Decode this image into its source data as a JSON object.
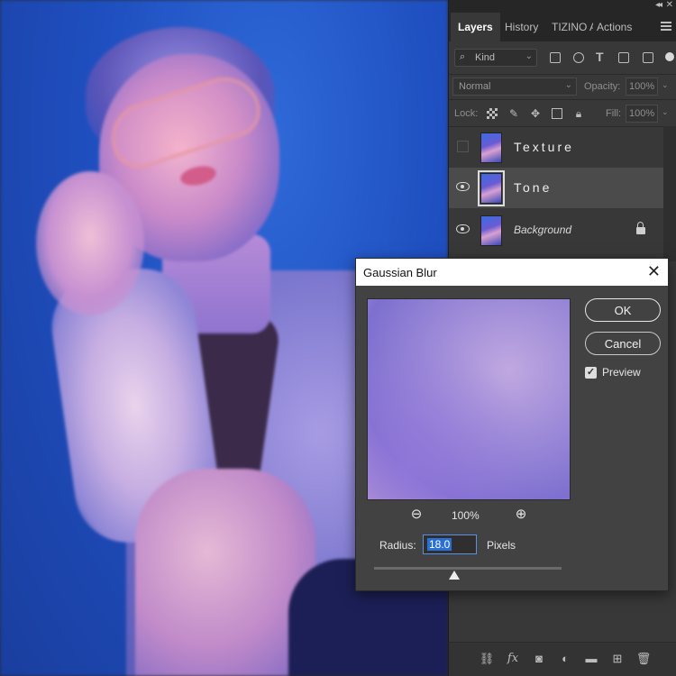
{
  "panel": {
    "tabs": [
      {
        "label": "Layers"
      },
      {
        "label": "History"
      },
      {
        "label": "TIZINO A"
      },
      {
        "label": "Actions"
      }
    ],
    "filter": {
      "kind_label": "Kind"
    },
    "blend_mode": "Normal",
    "opacity_label": "Opacity:",
    "opacity_value": "100%",
    "lock_label": "Lock:",
    "fill_label": "Fill:",
    "fill_value": "100%",
    "layers": [
      {
        "name": "Texture",
        "visible": false,
        "selected": false
      },
      {
        "name": "Tone",
        "visible": true,
        "selected": true
      },
      {
        "name": "Background",
        "visible": true,
        "selected": false,
        "locked": true
      }
    ]
  },
  "dialog": {
    "title": "Gaussian Blur",
    "ok_label": "OK",
    "cancel_label": "Cancel",
    "preview_label": "Preview",
    "preview_checked": true,
    "zoom_level": "100%",
    "radius_label": "Radius:",
    "radius_value": "18.0",
    "radius_unit": "Pixels",
    "radius_slider_fraction": 0.43
  },
  "icons": {
    "collapse": "double-chevron-right-icon",
    "panel_menu": "hamburger-menu-icon",
    "search": "search-icon",
    "close": "close-icon",
    "zoom_out": "zoom-out-icon",
    "zoom_in": "zoom-in-icon"
  },
  "colors": {
    "panel_bg": "#383838",
    "accent": "#2a6fd6",
    "dialog_bg": "#424242"
  }
}
